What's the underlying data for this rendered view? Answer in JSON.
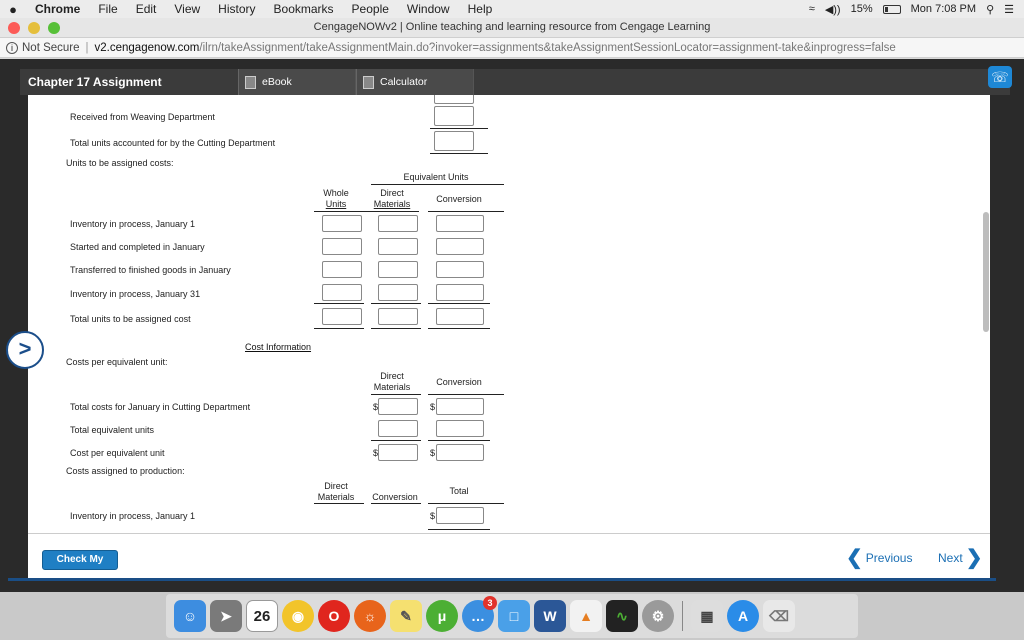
{
  "menubar": {
    "apple": "",
    "items": [
      "Chrome",
      "File",
      "Edit",
      "View",
      "History",
      "Bookmarks",
      "People",
      "Window",
      "Help"
    ],
    "volume": "◀))",
    "battery_pct": "15%",
    "clock": "Mon 7:08 PM"
  },
  "window": {
    "title": "CengageNOWv2 | Online teaching and learning resource from Cengage Learning"
  },
  "address": {
    "security": "Not Secure",
    "domain": "v2.cengagenow.com",
    "path": "/ilrn/takeAssignment/takeAssignmentMain.do?invoker=assignments&takeAssignmentSessionLocator=assignment-take&inprogress=false"
  },
  "toolbar": {
    "title": "Chapter 17 Assignment",
    "ebook": "eBook",
    "calculator": "Calculator"
  },
  "form": {
    "row_received": "Received from Weaving Department",
    "row_total_accounted": "Total units accounted for by the Cutting Department",
    "section_units": "Units to be assigned costs:",
    "equiv_units": "Equivalent Units",
    "col_whole_1": "Whole",
    "col_whole_2": "Units",
    "col_dm_1": "Direct",
    "col_dm_2": "Materials",
    "col_conversion": "Conversion",
    "rows": [
      "Inventory in process, January 1",
      "Started and completed in January",
      "Transferred to finished goods in January",
      "Inventory in process, January 31",
      "Total units to be assigned cost"
    ],
    "cost_info_link": "Cost Information",
    "section_costs_per": "Costs per equivalent unit:",
    "row_total_costs": "Total costs for January in Cutting Department",
    "row_total_equiv": "Total equivalent units",
    "row_cost_per": "Cost per equivalent unit",
    "section_assigned": "Costs assigned to production:",
    "col_total": "Total",
    "row_inv_jan1": "Inventory in process, January 1",
    "dollar": "$"
  },
  "nav": {
    "check": "Check My Work",
    "previous": "Previous",
    "next": "Next"
  },
  "dock": {
    "calendar_month": "FEB",
    "calendar_day": "26",
    "badge": "3"
  }
}
